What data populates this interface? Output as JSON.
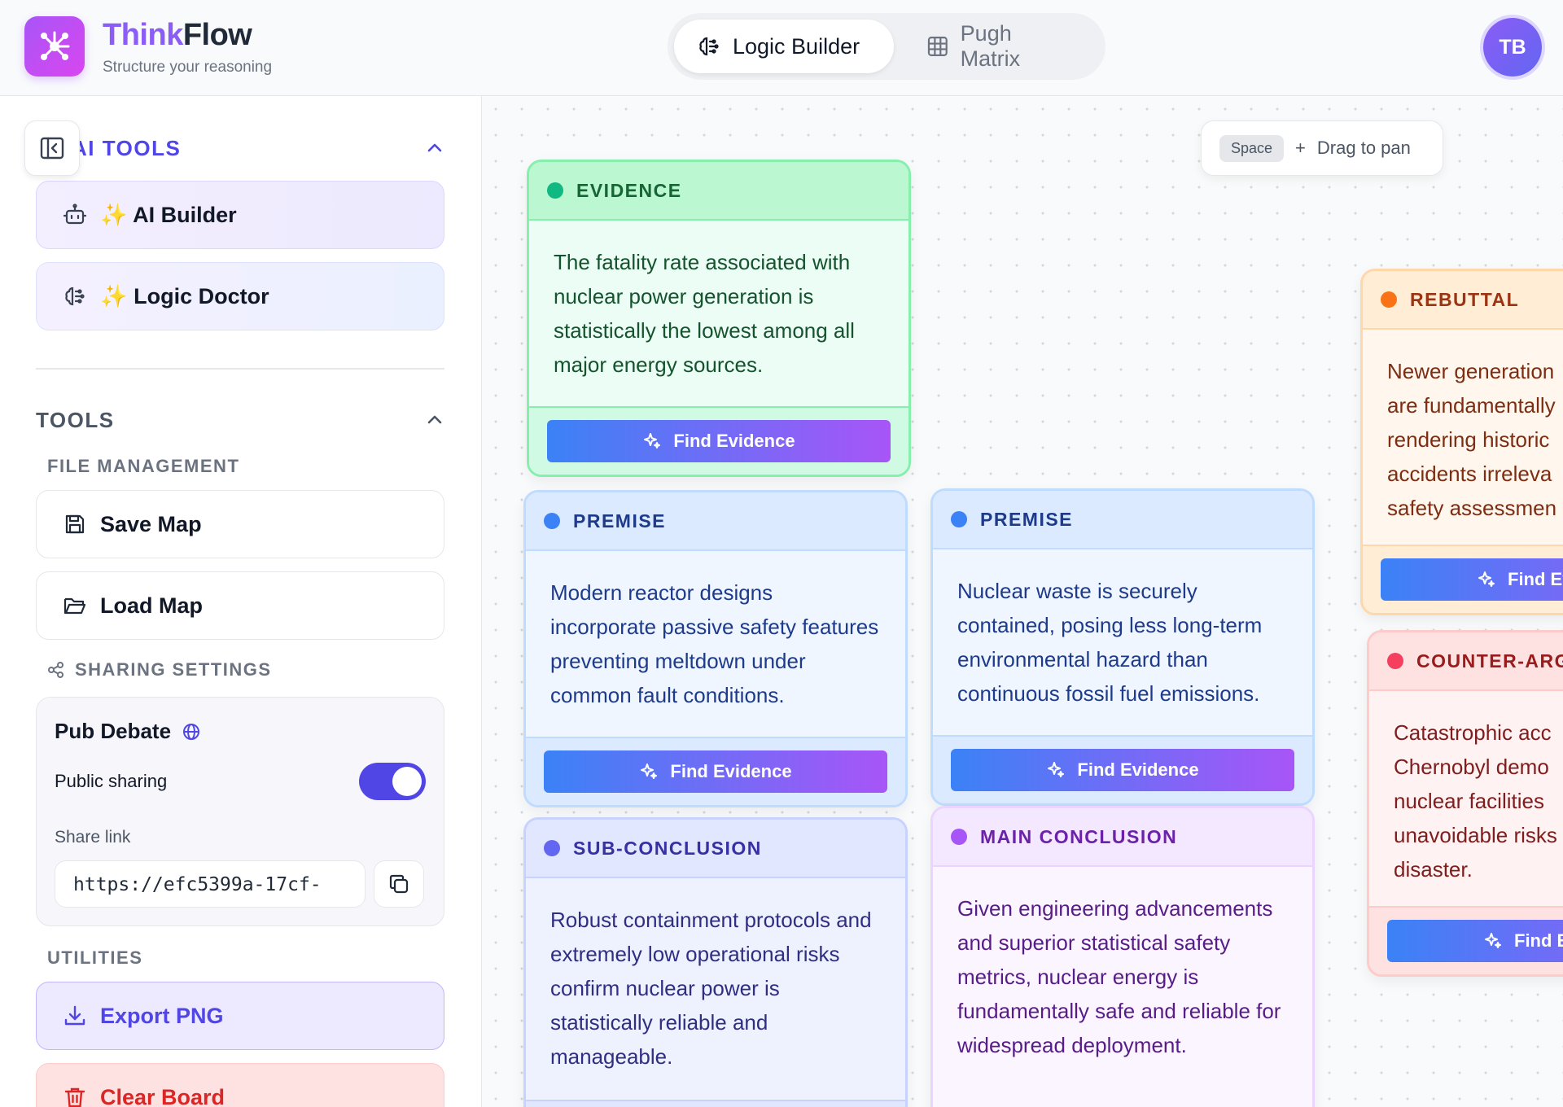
{
  "app": {
    "brand_part1": "Think",
    "brand_part2": "Flow",
    "tagline": "Structure your reasoning",
    "logo_icon": "network-icon"
  },
  "modes": {
    "logic_builder": "Logic Builder",
    "pugh_matrix": "Pugh Matrix",
    "active": "logic_builder"
  },
  "user": {
    "initials": "TB"
  },
  "sidebar": {
    "ai_tools": {
      "title": "AI TOOLS",
      "ai_builder": "✨ AI Builder",
      "logic_doctor": "✨ Logic Doctor"
    },
    "tools": {
      "title": "TOOLS",
      "file_management": "FILE MANAGEMENT",
      "save_map": "Save Map",
      "load_map": "Load Map",
      "sharing_settings": "SHARING SETTINGS",
      "share": {
        "map_name": "Pub Debate",
        "public_sharing_label": "Public sharing",
        "public_sharing_enabled": true,
        "share_link_label": "Share link",
        "share_link_value": "https://efc5399a-17cf-"
      },
      "utilities": "UTILITIES",
      "export_png": "Export PNG",
      "clear_board": "Clear Board"
    }
  },
  "canvas": {
    "pan_hint": {
      "key": "Space",
      "plus": "+",
      "text": "Drag to pan"
    },
    "find_evidence_label": "Find Evidence",
    "find_evidence_partial_1": "Find Ev",
    "find_evidence_partial_2": "Find E",
    "nodes": {
      "evidence": {
        "type": "EVIDENCE",
        "text": "The fatality rate associated with nuclear power generation is statistically the lowest among all major energy sources."
      },
      "premise_1": {
        "type": "PREMISE",
        "text": "Modern reactor designs incorporate passive safety features preventing meltdown under common fault conditions."
      },
      "premise_2": {
        "type": "PREMISE",
        "text": "Nuclear waste is securely contained, posing less long-term environmental hazard than continuous fossil fuel emissions."
      },
      "sub_conclusion": {
        "type": "SUB-CONCLUSION",
        "text": "Robust containment protocols and extremely low operational risks confirm nuclear power is statistically reliable and manageable."
      },
      "main_conclusion": {
        "type": "MAIN CONCLUSION",
        "text": "Given engineering advancements and superior statistical safety metrics, nuclear energy is fundamentally safe and reliable for widespread deployment."
      },
      "rebuttal": {
        "type": "REBUTTAL",
        "text": "Newer generation are fundamentally rendering historic accidents irreleva safety assessmen"
      },
      "counter_argument": {
        "type": "COUNTER-ARG",
        "text": "Catastrophic acc Chernobyl demo nuclear facilities unavoidable risks disaster."
      }
    }
  },
  "colors": {
    "accent": "#4f46e5",
    "brand_purple": "#a855f7",
    "evidence": "#10b981",
    "premise": "#3b82f6",
    "sub_conclusion": "#6366f1",
    "main_conclusion": "#a855f7",
    "rebuttal": "#f97316",
    "counter_argument": "#f43f5e"
  }
}
